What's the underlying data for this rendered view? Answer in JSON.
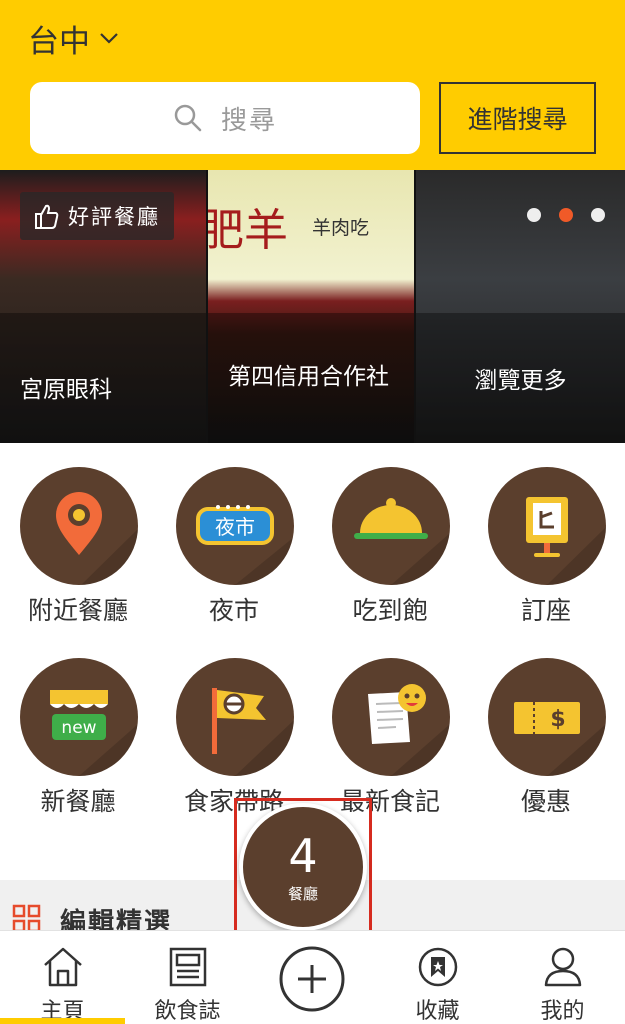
{
  "header": {
    "city": "台中",
    "search_placeholder": "搜尋",
    "advanced_search": "進階搜尋",
    "brand_color": "#FFCC00"
  },
  "banner": {
    "badge": "好評餐廳",
    "panels": [
      {
        "label": "宮原眼科"
      },
      {
        "label": "第四信用合作社",
        "sign_big": "肥羊",
        "sign_small": "羊肉吃"
      },
      {
        "label": "瀏覽更多"
      }
    ],
    "dots_total": 3,
    "active_dot": 2
  },
  "categories": [
    {
      "label": "附近餐廳",
      "icon": "location-pin-icon"
    },
    {
      "label": "夜市",
      "icon": "night-market-sign-icon",
      "icon_text": "夜市"
    },
    {
      "label": "吃到飽",
      "icon": "food-cloche-icon"
    },
    {
      "label": "訂座",
      "icon": "reservation-sign-icon"
    },
    {
      "label": "新餐廳",
      "icon": "new-shop-icon",
      "icon_text": "new"
    },
    {
      "label": "食家帶路",
      "icon": "flag-icon"
    },
    {
      "label": "最新食記",
      "icon": "blog-note-icon"
    },
    {
      "label": "優惠",
      "icon": "coupon-icon",
      "icon_text": "$"
    }
  ],
  "section": {
    "title": "編輯精選"
  },
  "fab": {
    "count": "4",
    "unit": "餐廳"
  },
  "nav": {
    "items": [
      {
        "label": "主頁",
        "icon": "home-icon",
        "active": true
      },
      {
        "label": "飲食誌",
        "icon": "magazine-icon"
      },
      {
        "label": "",
        "icon": "add-icon"
      },
      {
        "label": "收藏",
        "icon": "bookmark-icon"
      },
      {
        "label": "我的",
        "icon": "user-icon"
      }
    ]
  },
  "colors": {
    "accent": "#FFCC00",
    "icon_bg": "#5b3f2d",
    "highlight": "#d62b1f"
  }
}
